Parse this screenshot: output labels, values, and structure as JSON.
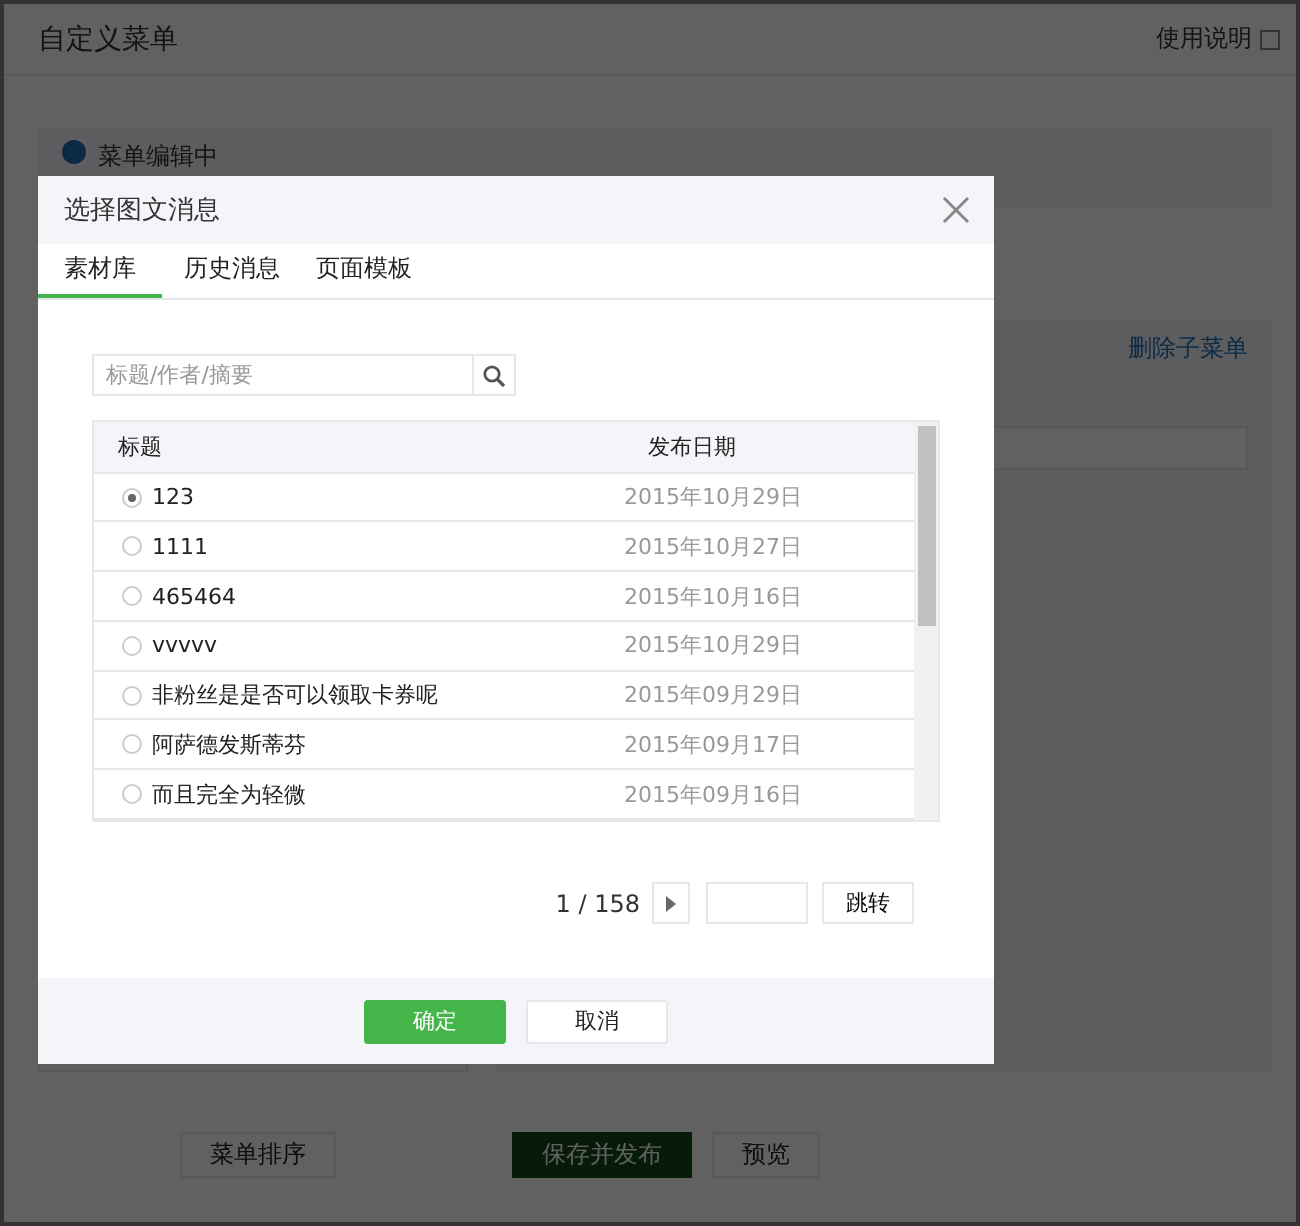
{
  "page": {
    "title": "自定义菜单",
    "help_link": "使用说明",
    "notice": "菜单编辑中",
    "delete_submenu_link": "删除子菜单",
    "bottom_buttons": [
      {
        "label": "菜单排序",
        "kind": "default"
      },
      {
        "label": "保存并发布",
        "kind": "primary"
      },
      {
        "label": "预览",
        "kind": "default"
      }
    ]
  },
  "dialog": {
    "title": "选择图文消息",
    "tabs": [
      {
        "label": "素材库",
        "selected": true
      },
      {
        "label": "历史消息",
        "selected": false
      },
      {
        "label": "页面模板",
        "selected": false
      }
    ],
    "search": {
      "placeholder": "标题/作者/摘要"
    },
    "table": {
      "columns": [
        "标题",
        "发布日期"
      ],
      "rows": [
        {
          "title": "123",
          "date": "2015年10月29日",
          "selected": true
        },
        {
          "title": "1111",
          "date": "2015年10月27日",
          "selected": false
        },
        {
          "title": "465464",
          "date": "2015年10月16日",
          "selected": false
        },
        {
          "title": "vvvvv",
          "date": "2015年10月29日",
          "selected": false
        },
        {
          "title": "非粉丝是是否可以领取卡券呢",
          "date": "2015年09月29日",
          "selected": false
        },
        {
          "title": "阿萨德发斯蒂芬",
          "date": "2015年09月17日",
          "selected": false
        },
        {
          "title": "而且完全为轻微",
          "date": "2015年09月16日",
          "selected": false
        }
      ]
    },
    "pagination": {
      "page_info": "1 / 158",
      "jump_button": "跳转"
    },
    "buttons": [
      {
        "label": "确定",
        "kind": "primary"
      },
      {
        "label": "取消",
        "kind": "default"
      }
    ]
  }
}
